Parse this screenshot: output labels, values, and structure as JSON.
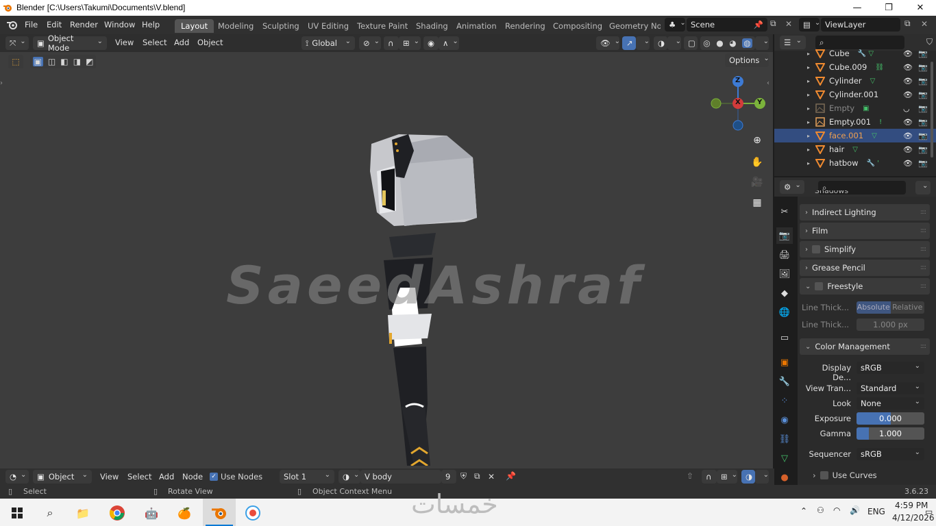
{
  "window": {
    "title": "Blender [C:\\Users\\Takumi\\Documents\\V.blend]",
    "minimize": "—",
    "maximize": "❐",
    "close": "✕"
  },
  "menubar": {
    "items": [
      "File",
      "Edit",
      "Render",
      "Window",
      "Help"
    ],
    "workspaces": [
      "Layout",
      "Modeling",
      "Sculpting",
      "UV Editing",
      "Texture Paint",
      "Shading",
      "Animation",
      "Rendering",
      "Compositing",
      "Geometry Noc"
    ],
    "active_workspace": "Layout",
    "scene": "Scene",
    "view_layer": "ViewLayer"
  },
  "viewport": {
    "mode": "Object Mode",
    "menus": [
      "View",
      "Select",
      "Add",
      "Object"
    ],
    "orientation": "Global",
    "options": "Options",
    "gizmo": {
      "x": "X",
      "y": "Y",
      "z": "Z"
    },
    "watermark": "SaeedAshraf"
  },
  "outliner": {
    "items": [
      {
        "name": "Cube",
        "extra": "🔧 ▽"
      },
      {
        "name": "Cube.009",
        "extra": "⛓"
      },
      {
        "name": "Cylinder",
        "extra": "▽"
      },
      {
        "name": "Cylinder.001",
        "extra": ""
      },
      {
        "name": "Empty",
        "extra": "▣",
        "dim": true
      },
      {
        "name": "Empty.001",
        "extra": "!"
      },
      {
        "name": "face.001",
        "extra": "▽",
        "selected": true
      },
      {
        "name": "hair",
        "extra": "▽"
      },
      {
        "name": "hatbow",
        "extra": "🔧 '"
      }
    ]
  },
  "properties": {
    "partial_top": "Shadows",
    "panels": {
      "indirect": "Indirect Lighting",
      "film": "Film",
      "simplify": "Simplify",
      "grease": "Grease Pencil",
      "freestyle": "Freestyle",
      "color_mgmt": "Color Management"
    },
    "line_thickness_label": "Line Thick...",
    "line_thick_mode_abs": "Absolute",
    "line_thick_mode_rel": "Relative",
    "line_thickness_label2": "Line Thick...",
    "line_thickness_value": "1.000 px",
    "display_device_label": "Display De...",
    "display_device": "sRGB",
    "view_transform_label": "View Tran...",
    "view_transform": "Standard",
    "look_label": "Look",
    "look": "None",
    "exposure_label": "Exposure",
    "exposure": "0.000",
    "gamma_label": "Gamma",
    "gamma": "1.000",
    "sequencer_label": "Sequencer",
    "sequencer": "sRGB",
    "use_curves": "Use Curves"
  },
  "editor": {
    "type": "Object",
    "menus": [
      "View",
      "Select",
      "Add",
      "Node"
    ],
    "use_nodes": "Use Nodes",
    "slot": "Slot 1",
    "material": "V body",
    "users": "9"
  },
  "status": {
    "select": "Select",
    "rotate": "Rotate View",
    "context": "Object Context Menu",
    "version": "3.6.23"
  },
  "taskbar": {
    "lang": "ENG",
    "time": "4:59 PM",
    "date": "4/12/2026",
    "watermark": "خمسات"
  }
}
